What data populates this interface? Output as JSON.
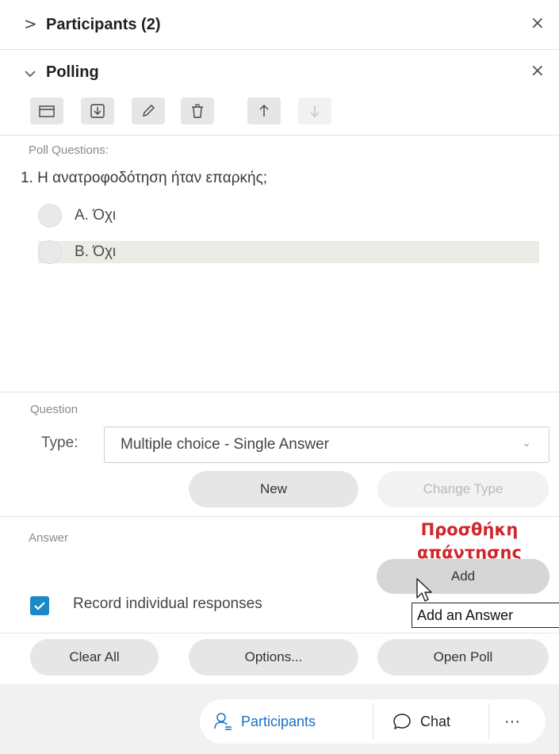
{
  "header": {
    "participants": {
      "title": "Participants (2)",
      "expand_icon": "chevron-right-icon",
      "close": "×"
    },
    "polling": {
      "title": "Polling",
      "expand_icon": "chevron-down-icon",
      "close": "×"
    }
  },
  "toolbar": {
    "buttons": [
      {
        "name": "open-poll-file",
        "icon": "folder-icon",
        "enabled": true
      },
      {
        "name": "save-poll",
        "icon": "download-icon",
        "enabled": true
      },
      {
        "name": "edit",
        "icon": "pencil-icon",
        "enabled": true
      },
      {
        "name": "delete",
        "icon": "trash-icon",
        "enabled": true
      },
      {
        "name": "move-up",
        "icon": "arrow-up-icon",
        "enabled": true
      },
      {
        "name": "move-down",
        "icon": "arrow-down-icon",
        "enabled": false
      }
    ]
  },
  "poll": {
    "section_label": "Poll Questions:",
    "question": "1. Η ανατροφοδότηση ήταν επαρκής;",
    "answers": [
      {
        "label": "A.  Όχι"
      },
      {
        "label": "B.  Όχι",
        "highlighted": true
      }
    ]
  },
  "question_section": {
    "label": "Question",
    "type_label": "Type:",
    "type_value": "Multiple choice - Single Answer",
    "new_button": "New",
    "change_type_button": "Change Type"
  },
  "answer_section": {
    "label": "Answer",
    "annotation": "Προσθήκη απάντησης",
    "add_button": "Add",
    "tooltip": "Add an Answer"
  },
  "record": {
    "label": "Record individual responses",
    "checked": true
  },
  "actions": {
    "clear_all": "Clear All",
    "options": "Options...",
    "open_poll": "Open Poll"
  },
  "footer": {
    "participants": "Participants",
    "chat": "Chat",
    "more": "···"
  },
  "colors": {
    "accent": "#1a89c8",
    "annotation": "#d0262d"
  }
}
